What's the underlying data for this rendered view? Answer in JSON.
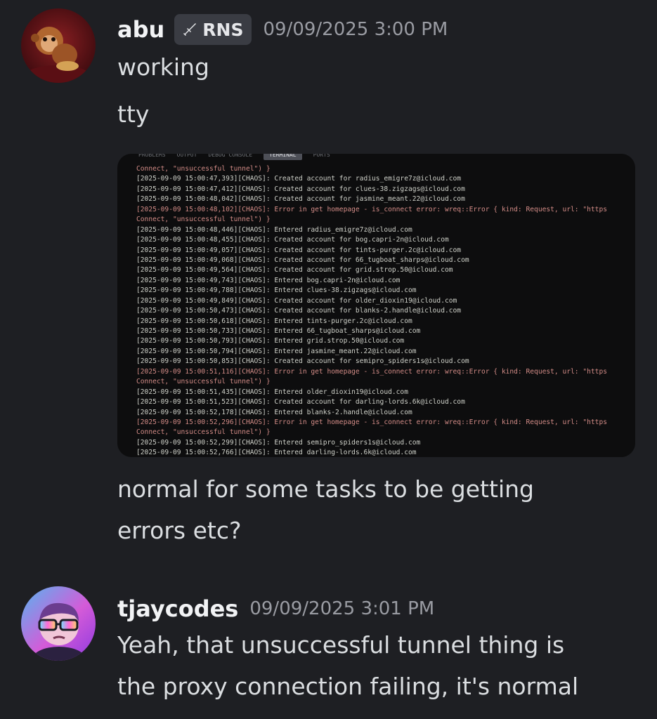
{
  "messages": [
    {
      "username": "abu",
      "tag": "RNS",
      "tag_icon": "sword-icon",
      "timestamp": "09/09/2025 3:00 PM",
      "lines": [
        "working",
        "tty"
      ],
      "after_lines": [
        "normal for some tasks to be getting",
        "errors etc?"
      ]
    },
    {
      "username": "tjaycodes",
      "timestamp": "09/09/2025 3:01 PM",
      "lines": [
        "Yeah, that unsuccessful tunnel thing is",
        "the proxy connection failing, it's normal"
      ]
    }
  ],
  "terminal": {
    "tabs": [
      "PROBLEMS",
      "OUTPUT",
      "DEBUG CONSOLE",
      "TERMINAL",
      "PORTS"
    ],
    "active_tab": 3,
    "lines": [
      {
        "text": "Connect, \"unsuccessful tunnel\") }",
        "error": true
      },
      {
        "text": "[2025-09-09 15:00:47,393][CHAOS]: Created account for radius_emigre7z@icloud.com",
        "error": false
      },
      {
        "text": "[2025-09-09 15:00:47,412][CHAOS]: Created account for clues-38.zigzags@icloud.com",
        "error": false
      },
      {
        "text": "[2025-09-09 15:00:48,042][CHAOS]: Created account for jasmine_meant.22@icloud.com",
        "error": false
      },
      {
        "text": "[2025-09-09 15:00:48,102][CHAOS]: Error in get homepage - is_connect error: wreq::Error { kind: Request, url: \"https",
        "error": true
      },
      {
        "text": "Connect, \"unsuccessful tunnel\") }",
        "error": true
      },
      {
        "text": "[2025-09-09 15:00:48,446][CHAOS]: Entered radius_emigre7z@icloud.com",
        "error": false
      },
      {
        "text": "[2025-09-09 15:00:48,455][CHAOS]: Created account for bog.capri-2n@icloud.com",
        "error": false
      },
      {
        "text": "[2025-09-09 15:00:49,057][CHAOS]: Created account for tints-purger.2c@icloud.com",
        "error": false
      },
      {
        "text": "[2025-09-09 15:00:49,068][CHAOS]: Created account for 66_tugboat_sharps@icloud.com",
        "error": false
      },
      {
        "text": "[2025-09-09 15:00:49,564][CHAOS]: Created account for grid.strop.50@icloud.com",
        "error": false
      },
      {
        "text": "[2025-09-09 15:00:49,743][CHAOS]: Entered bog.capri-2n@icloud.com",
        "error": false
      },
      {
        "text": "[2025-09-09 15:00:49,788][CHAOS]: Entered clues-38.zigzags@icloud.com",
        "error": false
      },
      {
        "text": "[2025-09-09 15:00:49,849][CHAOS]: Created account for older_dioxin19@icloud.com",
        "error": false
      },
      {
        "text": "[2025-09-09 15:00:50,473][CHAOS]: Created account for blanks-2.handle@icloud.com",
        "error": false
      },
      {
        "text": "[2025-09-09 15:00:50,618][CHAOS]: Entered tints-purger.2c@icloud.com",
        "error": false
      },
      {
        "text": "[2025-09-09 15:00:50,733][CHAOS]: Entered 66_tugboat_sharps@icloud.com",
        "error": false
      },
      {
        "text": "[2025-09-09 15:00:50,793][CHAOS]: Entered grid.strop.50@icloud.com",
        "error": false
      },
      {
        "text": "[2025-09-09 15:00:50,794][CHAOS]: Entered jasmine_meant.22@icloud.com",
        "error": false
      },
      {
        "text": "[2025-09-09 15:00:50,853][CHAOS]: Created account for semipro_spiders1s@icloud.com",
        "error": false
      },
      {
        "text": "[2025-09-09 15:00:51,116][CHAOS]: Error in get homepage - is_connect error: wreq::Error { kind: Request, url: \"https",
        "error": true
      },
      {
        "text": "Connect, \"unsuccessful tunnel\") }",
        "error": true
      },
      {
        "text": "[2025-09-09 15:00:51,435][CHAOS]: Entered older_dioxin19@icloud.com",
        "error": false
      },
      {
        "text": "[2025-09-09 15:00:51,523][CHAOS]: Created account for darling-lords.6k@icloud.com",
        "error": false
      },
      {
        "text": "[2025-09-09 15:00:52,178][CHAOS]: Entered blanks-2.handle@icloud.com",
        "error": false
      },
      {
        "text": "[2025-09-09 15:00:52,296][CHAOS]: Error in get homepage - is_connect error: wreq::Error { kind: Request, url: \"https",
        "error": true
      },
      {
        "text": "Connect, \"unsuccessful tunnel\") }",
        "error": true
      },
      {
        "text": "[2025-09-09 15:00:52,299][CHAOS]: Entered semipro_spiders1s@icloud.com",
        "error": false
      },
      {
        "text": "[2025-09-09 15:00:52,766][CHAOS]: Entered darling-lords.6k@icloud.com",
        "error": false
      }
    ]
  },
  "colors": {
    "background": "#1e1f23",
    "username": "#f2f3f5",
    "timestamp": "#9a9ca3",
    "tag_bg": "#3a3c43",
    "terminal_bg": "#0d0d0e",
    "terminal_error": "#d28b86"
  }
}
